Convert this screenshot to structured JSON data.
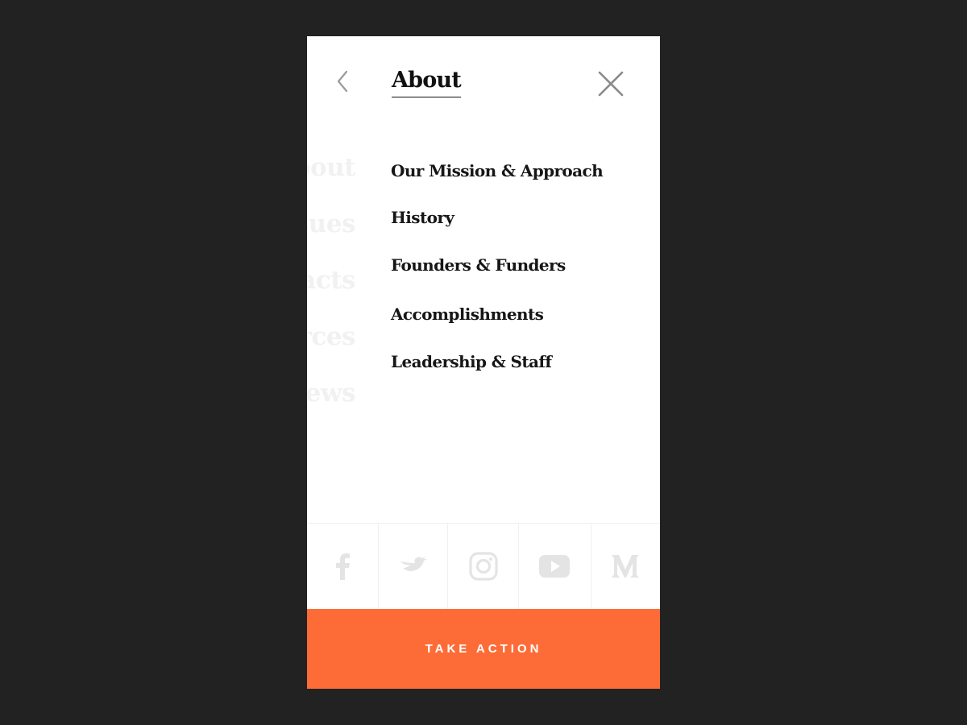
{
  "header": {
    "title": "About",
    "back_icon": "chevron-left-icon",
    "close_icon": "close-icon"
  },
  "background_menu": {
    "items": [
      "About",
      "Issues",
      "Impacts",
      "Resources",
      "News"
    ]
  },
  "submenu": {
    "items": [
      "Our Mission & Approach",
      "History",
      "Founders & Funders",
      "Accomplishments",
      "Leadership & Staff"
    ]
  },
  "social": {
    "icons": [
      "facebook-icon",
      "twitter-icon",
      "instagram-icon",
      "youtube-icon",
      "medium-icon"
    ]
  },
  "cta": {
    "label": "TAKE ACTION",
    "color": "#fd6c37"
  },
  "colors": {
    "background": "#222222",
    "panel": "#ffffff",
    "text": "#161616",
    "ghost_text": "#f1f1f1",
    "icon_muted": "#e6e6e6"
  }
}
